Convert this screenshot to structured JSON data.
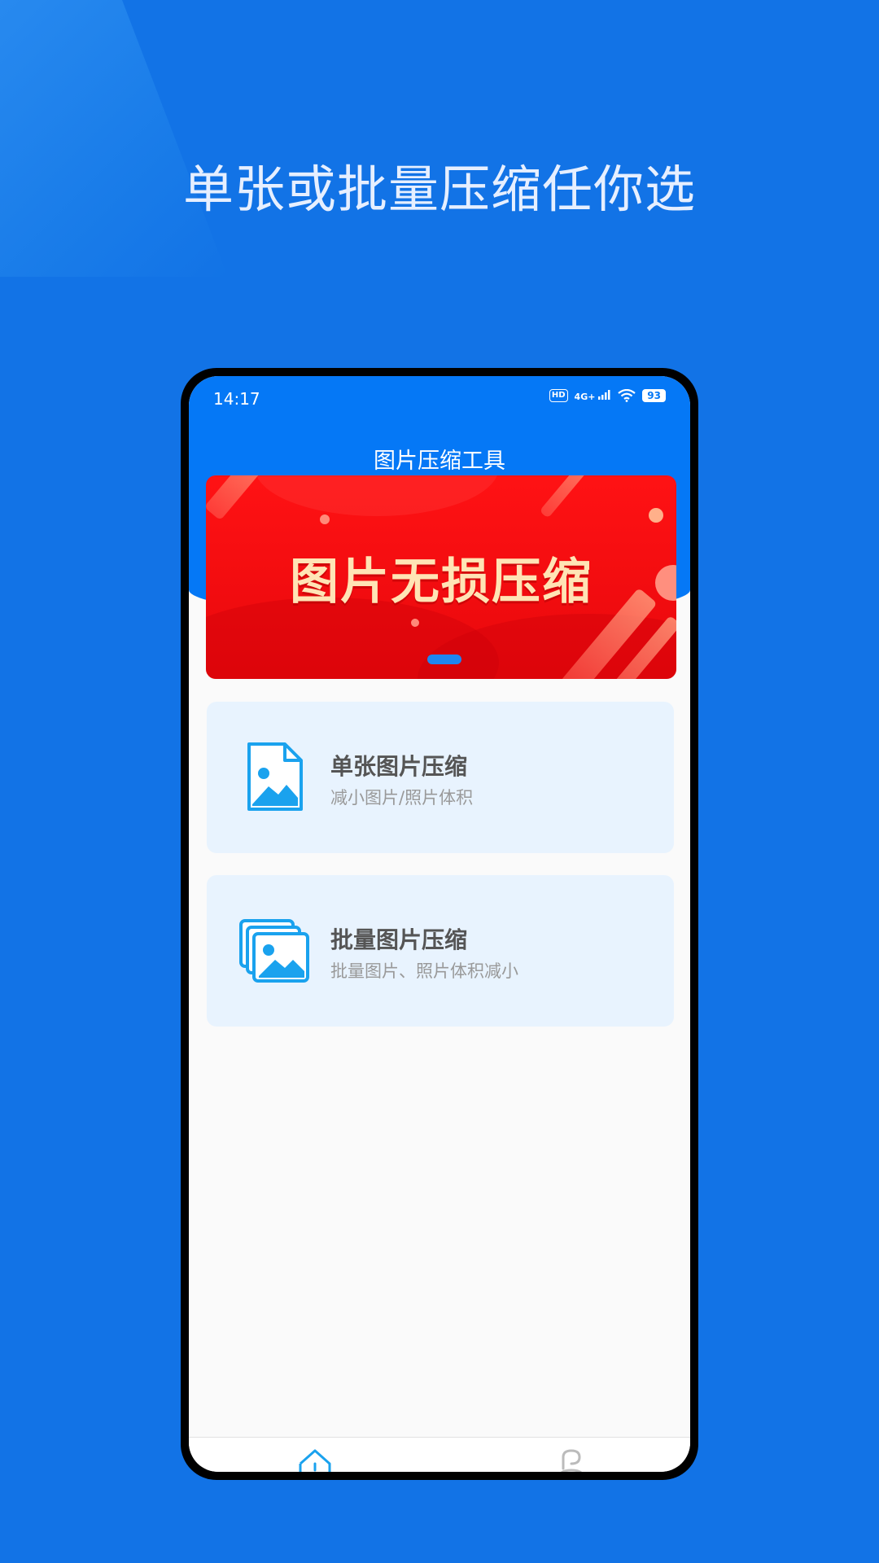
{
  "promo": {
    "title": "单张或批量压缩任你选"
  },
  "status_bar": {
    "time": "14:17",
    "hd": "HD",
    "network": "4G+",
    "battery": "93"
  },
  "app": {
    "title": "图片压缩工具"
  },
  "banner": {
    "text": "图片无损压缩"
  },
  "cards": [
    {
      "title": "单张图片压缩",
      "subtitle": "减小图片/照片体积",
      "icon": "single-image-file-icon"
    },
    {
      "title": "批量图片压缩",
      "subtitle": "批量图片、照片体积减小",
      "icon": "stacked-images-icon"
    }
  ],
  "tabbar": {
    "items": [
      {
        "icon": "home-icon"
      },
      {
        "icon": "profile-icon"
      }
    ]
  },
  "colors": {
    "background": "#1273e6",
    "header_blue": "#0578f6",
    "banner_red": "#ff1214",
    "card_bg": "#e8f3fe",
    "icon_blue": "#1aa2ee"
  }
}
